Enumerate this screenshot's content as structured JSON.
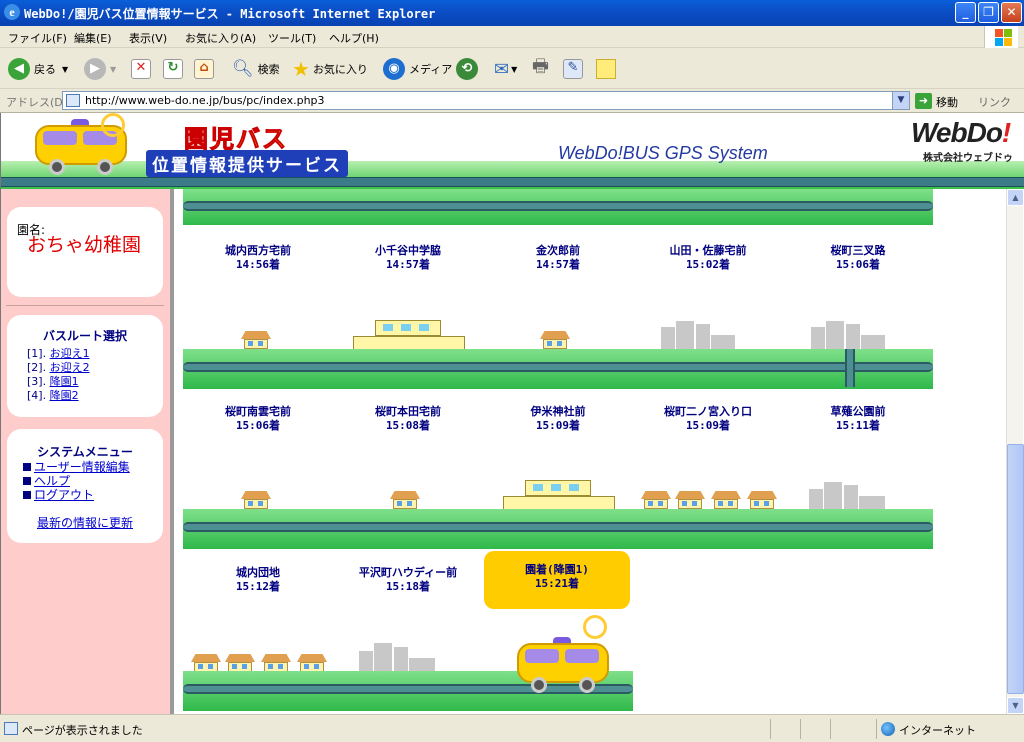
{
  "window": {
    "title": "WebDo!/園児バス位置情報サービス - Microsoft Internet Explorer",
    "minimize": "_",
    "maximize": "❐",
    "close": "✕"
  },
  "menu": [
    "ファイル(F)",
    "編集(E)",
    "表示(V)",
    "お気に入り(A)",
    "ツール(T)",
    "ヘルプ(H)"
  ],
  "toolbar": {
    "back": "戻る",
    "search": "検索",
    "favorites": "お気に入り",
    "media": "メディア"
  },
  "address": {
    "label": "アドレス(D)",
    "url": "http://www.web-do.ne.jp/bus/pc/index.php3",
    "go": "移動",
    "links": "リンク"
  },
  "banner": {
    "title_main": "園児バス",
    "title_sub": "位置情報提供サービス",
    "system": "WebDo!BUS GPS System",
    "brand": "WebDo",
    "brand_mark": "!",
    "brand_sub": "株式会社ウェブドゥ"
  },
  "sidebar": {
    "kindergarten_label": "園名:",
    "kindergarten_name": "おちゃ幼稚園",
    "route_title": "バスルート選択",
    "routes": [
      {
        "num": "[1].",
        "label": "お迎え1"
      },
      {
        "num": "[2].",
        "label": "お迎え2"
      },
      {
        "num": "[3].",
        "label": "降園1"
      },
      {
        "num": "[4].",
        "label": "降園2"
      }
    ],
    "system_title": "システムメニュー",
    "system_items": [
      "ユーザー情報編集",
      "ヘルプ",
      "ログアウト"
    ],
    "refresh": "最新の情報に更新"
  },
  "stops": [
    {
      "name": "城内西方宅前",
      "time": "14:56着"
    },
    {
      "name": "小千谷中学脇",
      "time": "14:57着"
    },
    {
      "name": "金次郎前",
      "time": "14:57着"
    },
    {
      "name": "山田・佐藤宅前",
      "time": "15:02着"
    },
    {
      "name": "桜町三叉路",
      "time": "15:06着"
    },
    {
      "name": "桜町南雲宅前",
      "time": "15:06着"
    },
    {
      "name": "桜町本田宅前",
      "time": "15:08着"
    },
    {
      "name": "伊米神社前",
      "time": "15:09着"
    },
    {
      "name": "桜町二ノ宮入り口",
      "time": "15:09着"
    },
    {
      "name": "草薙公園前",
      "time": "15:11着"
    },
    {
      "name": "城内団地",
      "time": "15:12着"
    },
    {
      "name": "平沢町ハウディー前",
      "time": "15:18着"
    },
    {
      "name": "園着(降園1)",
      "time": "15:21着",
      "current": true
    }
  ],
  "status": {
    "message": "ページが表示されました",
    "zone": "インターネット"
  },
  "colors": {
    "sidebar_bg": "#ffcccc",
    "current_stop": "#ffcc00",
    "stop_text": "#000080",
    "kindergarten_name": "#e00000"
  }
}
